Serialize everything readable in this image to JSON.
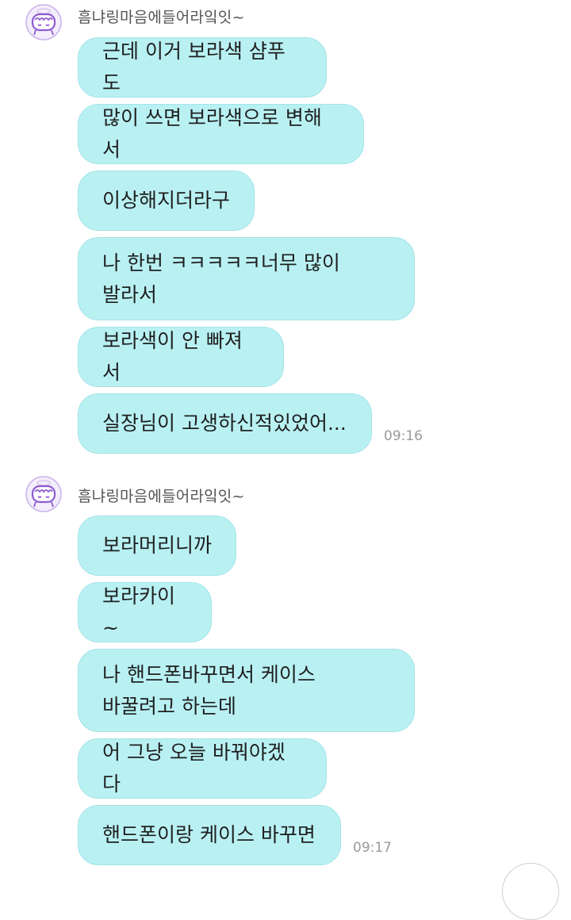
{
  "groups": [
    {
      "sender": "흠냐링마음에들어라잌잇~",
      "messages": [
        "근데 이거 보라색 샴푸도",
        "많이 쓰면 보라색으로 변해서",
        "이상해지더라구",
        "나 한번 ㅋㅋㅋㅋㅋ너무 많이\n발라서",
        "보라색이 안 빠져서",
        "실장님이 고생하신적있었어..."
      ],
      "time": "09:16"
    },
    {
      "sender": "흠냐링마음에들어라잌잇~",
      "messages": [
        "보라머리니까",
        "보라카이~",
        "나 핸드폰바꾸면서 케이스\n바꿀려고 하는데",
        "어 그냥 오늘 바꿔야겠다",
        "핸드폰이랑 케이스 바꾸면"
      ],
      "time": "09:17"
    }
  ],
  "colors": {
    "bubble": "#b9f1f3",
    "bubble_border": "#a3e3e8",
    "avatar_accent": "#8e5bd1"
  },
  "icons": {
    "avatar": "cartoon-cake-avatar-icon"
  }
}
